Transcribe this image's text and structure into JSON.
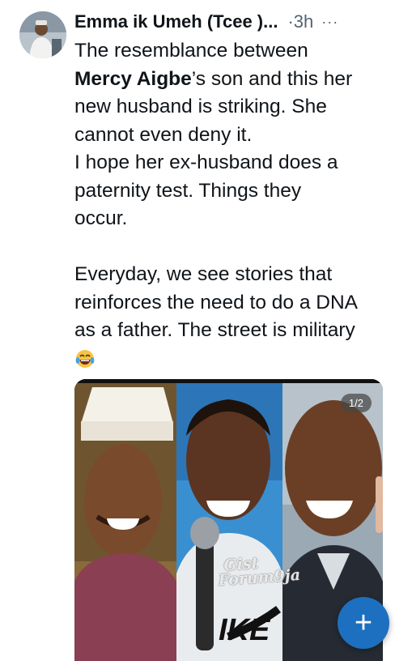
{
  "tweet": {
    "author_name": "Emma ik Umeh (Tcee )...",
    "separator": "·",
    "time": "3h",
    "more_label": "···",
    "line_1": "The resemblance between",
    "mention": "Mercy Aigbe",
    "line_2_rest": "’s son and this her",
    "line_3": "new husband is striking. She",
    "line_4": "cannot even deny it.",
    "line_5": "I hope her ex-husband does a",
    "line_6": "paternity test. Things they",
    "line_7": "occur.",
    "line_8": "Everyday, we see stories that",
    "line_9": "reinforces the need to do a DNA",
    "line_10": "as a father. The street is military",
    "emoji_icon": "laughing-tears-emoji"
  },
  "media": {
    "counter": "1/2",
    "watermark_line1": "Gist",
    "watermark_line2": "Forum9ja",
    "shirt_text": "IKE"
  },
  "fab": {
    "label": "+",
    "color": "#1d6fbf"
  }
}
